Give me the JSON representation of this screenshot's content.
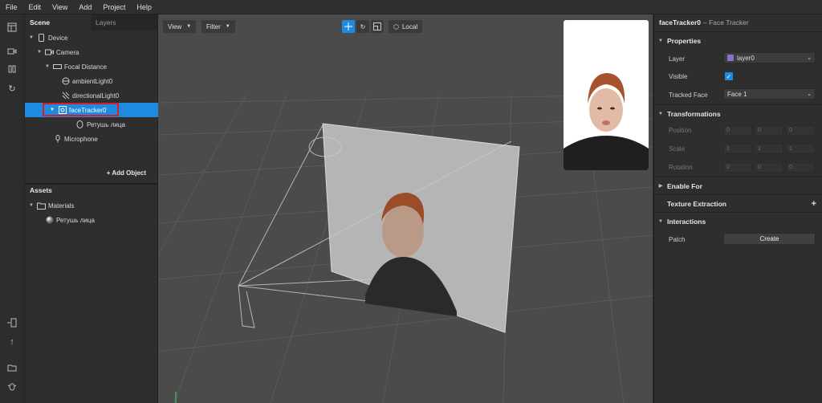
{
  "menu": [
    "File",
    "Edit",
    "View",
    "Add",
    "Project",
    "Help"
  ],
  "scene_tabs": {
    "scene": "Scene",
    "layers": "Layers"
  },
  "tree": [
    {
      "label": "Device",
      "icon": "phone-icon",
      "level": 0
    },
    {
      "label": "Camera",
      "icon": "camera-icon",
      "level": 1
    },
    {
      "label": "Focal Distance",
      "icon": "focal-distance-icon",
      "level": 2
    },
    {
      "label": "ambientLight0",
      "icon": "ambient-light-icon",
      "level": 3
    },
    {
      "label": "directionalLight0",
      "icon": "directional-light-icon",
      "level": 3
    },
    {
      "label": "faceTracker0",
      "icon": "face-tracker-icon",
      "level": 3,
      "selected": true
    },
    {
      "label": "Ретушь лица",
      "icon": "face-mesh-icon",
      "level": 4
    },
    {
      "label": "Microphone",
      "icon": "microphone-icon",
      "level": 1
    }
  ],
  "add_object": "+ Add Object",
  "assets": {
    "title": "Assets",
    "folder": "Materials",
    "material": "Ретушь лица"
  },
  "viewport": {
    "view_label": "View",
    "filter_label": "Filter",
    "space_label": "Local"
  },
  "inspector": {
    "title_name": "faceTracker0",
    "title_type": "– Face Tracker",
    "properties": "Properties",
    "layer_label": "Layer",
    "layer_value": "layer0",
    "layer_color": "#8a6fd1",
    "visible_label": "Visible",
    "visible_checked": true,
    "tracked_face_label": "Tracked Face",
    "tracked_face_value": "Face 1",
    "transformations": "Transformations",
    "position_label": "Position",
    "position": [
      "0",
      "0",
      "0"
    ],
    "scale_label": "Scale",
    "scale": [
      "1",
      "1",
      "1"
    ],
    "rotation_label": "Rotation",
    "rotation": [
      "0",
      "0",
      "0"
    ],
    "enable_for": "Enable For",
    "texture_extraction": "Texture Extraction",
    "interactions": "Interactions",
    "patch_label": "Patch",
    "create_label": "Create"
  },
  "colors": {
    "accent": "#1e8be0",
    "highlight": "#d0202b"
  }
}
